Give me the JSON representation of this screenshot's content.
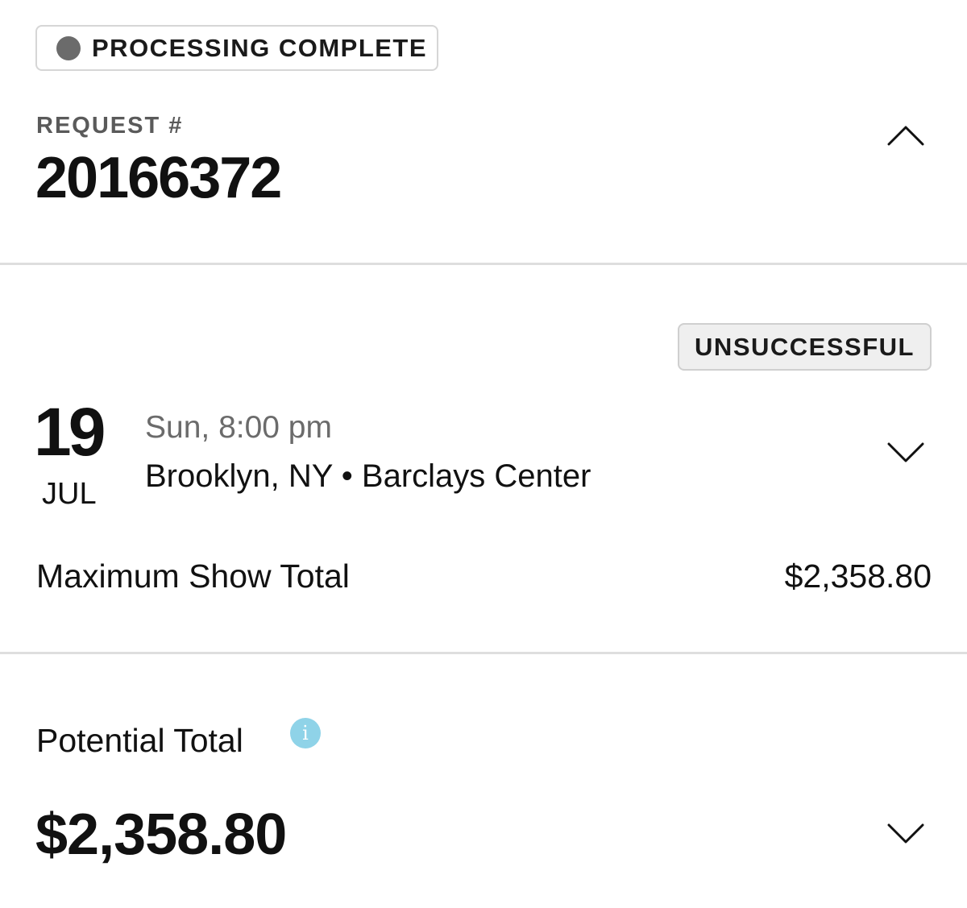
{
  "status": {
    "label": "PROCESSING COMPLETE",
    "dot_color": "#6b6b6b"
  },
  "request": {
    "label": "REQUEST #",
    "number": "20166372",
    "toggle_icon": "chevron-up-icon"
  },
  "show": {
    "result_badge": "UNSUCCESSFUL",
    "day": "19",
    "month": "JUL",
    "time": "Sun, 8:00 pm",
    "location": "Brooklyn, NY • Barclays Center",
    "toggle_icon": "chevron-down-icon",
    "max_total_label": "Maximum Show Total",
    "max_total_value": "$2,358.80"
  },
  "potential": {
    "label": "Potential Total",
    "info_icon": "info-icon",
    "info_glyph": "i",
    "info_color": "#8fd3e8",
    "value": "$2,358.80",
    "toggle_icon": "chevron-down-icon"
  }
}
